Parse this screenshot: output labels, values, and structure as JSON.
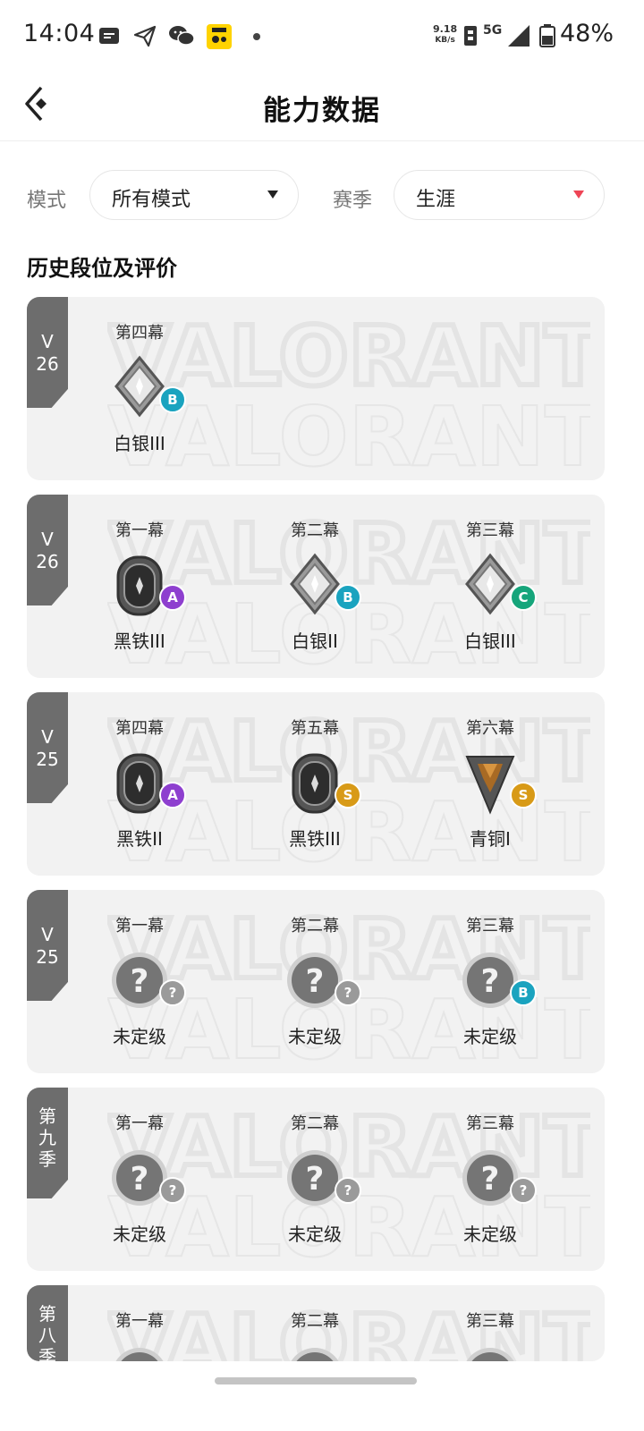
{
  "status_bar": {
    "time": "14:04",
    "net_speed": "9.18",
    "net_unit": "KB/s",
    "network": "5G",
    "battery": "48%",
    "icons": [
      "message-icon",
      "send-icon",
      "wechat-icon",
      "app-icon",
      "dot-icon",
      "sim-icon",
      "signal-icon",
      "battery-icon"
    ]
  },
  "header": {
    "title": "能力数据",
    "back_icon": "back-arrow-icon"
  },
  "filters": {
    "mode_label": "模式",
    "mode_value": "所有模式",
    "season_label": "赛季",
    "season_value": "生涯"
  },
  "section_title": "历史段位及评价",
  "grade_colors": {
    "A": "#8e3fcf",
    "B": "#1aa3bf",
    "C": "#16a57b",
    "S": "#d89a17",
    "?": "#9a9a9a"
  },
  "seasons": [
    {
      "tag": "V 26",
      "acts": [
        {
          "label": "第四幕",
          "rank": "白银III",
          "emblem": "silver-rank-icon",
          "grade": "B"
        }
      ]
    },
    {
      "tag": "V 26",
      "acts": [
        {
          "label": "第一幕",
          "rank": "黑铁III",
          "emblem": "iron-rank-icon",
          "grade": "A"
        },
        {
          "label": "第二幕",
          "rank": "白银II",
          "emblem": "silver-rank-icon",
          "grade": "B"
        },
        {
          "label": "第三幕",
          "rank": "白银III",
          "emblem": "silver-rank-icon",
          "grade": "C"
        }
      ]
    },
    {
      "tag": "V 25",
      "acts": [
        {
          "label": "第四幕",
          "rank": "黑铁II",
          "emblem": "iron-rank-icon",
          "grade": "A"
        },
        {
          "label": "第五幕",
          "rank": "黑铁III",
          "emblem": "iron-rank-icon",
          "grade": "S"
        },
        {
          "label": "第六幕",
          "rank": "青铜I",
          "emblem": "bronze-rank-icon",
          "grade": "S"
        }
      ]
    },
    {
      "tag": "V 25",
      "acts": [
        {
          "label": "第一幕",
          "rank": "未定级",
          "emblem": "unranked-icon",
          "grade": "?"
        },
        {
          "label": "第二幕",
          "rank": "未定级",
          "emblem": "unranked-icon",
          "grade": "?"
        },
        {
          "label": "第三幕",
          "rank": "未定级",
          "emblem": "unranked-icon",
          "grade": "B"
        }
      ]
    },
    {
      "tag": "第九季",
      "acts": [
        {
          "label": "第一幕",
          "rank": "未定级",
          "emblem": "unranked-icon",
          "grade": "?"
        },
        {
          "label": "第二幕",
          "rank": "未定级",
          "emblem": "unranked-icon",
          "grade": "?"
        },
        {
          "label": "第三幕",
          "rank": "未定级",
          "emblem": "unranked-icon",
          "grade": "?"
        }
      ]
    },
    {
      "tag": "第八季",
      "acts": [
        {
          "label": "第一幕",
          "rank": "",
          "emblem": "unranked-icon",
          "grade": ""
        },
        {
          "label": "第二幕",
          "rank": "",
          "emblem": "unranked-icon",
          "grade": ""
        },
        {
          "label": "第三幕",
          "rank": "",
          "emblem": "unranked-icon",
          "grade": ""
        }
      ]
    }
  ]
}
